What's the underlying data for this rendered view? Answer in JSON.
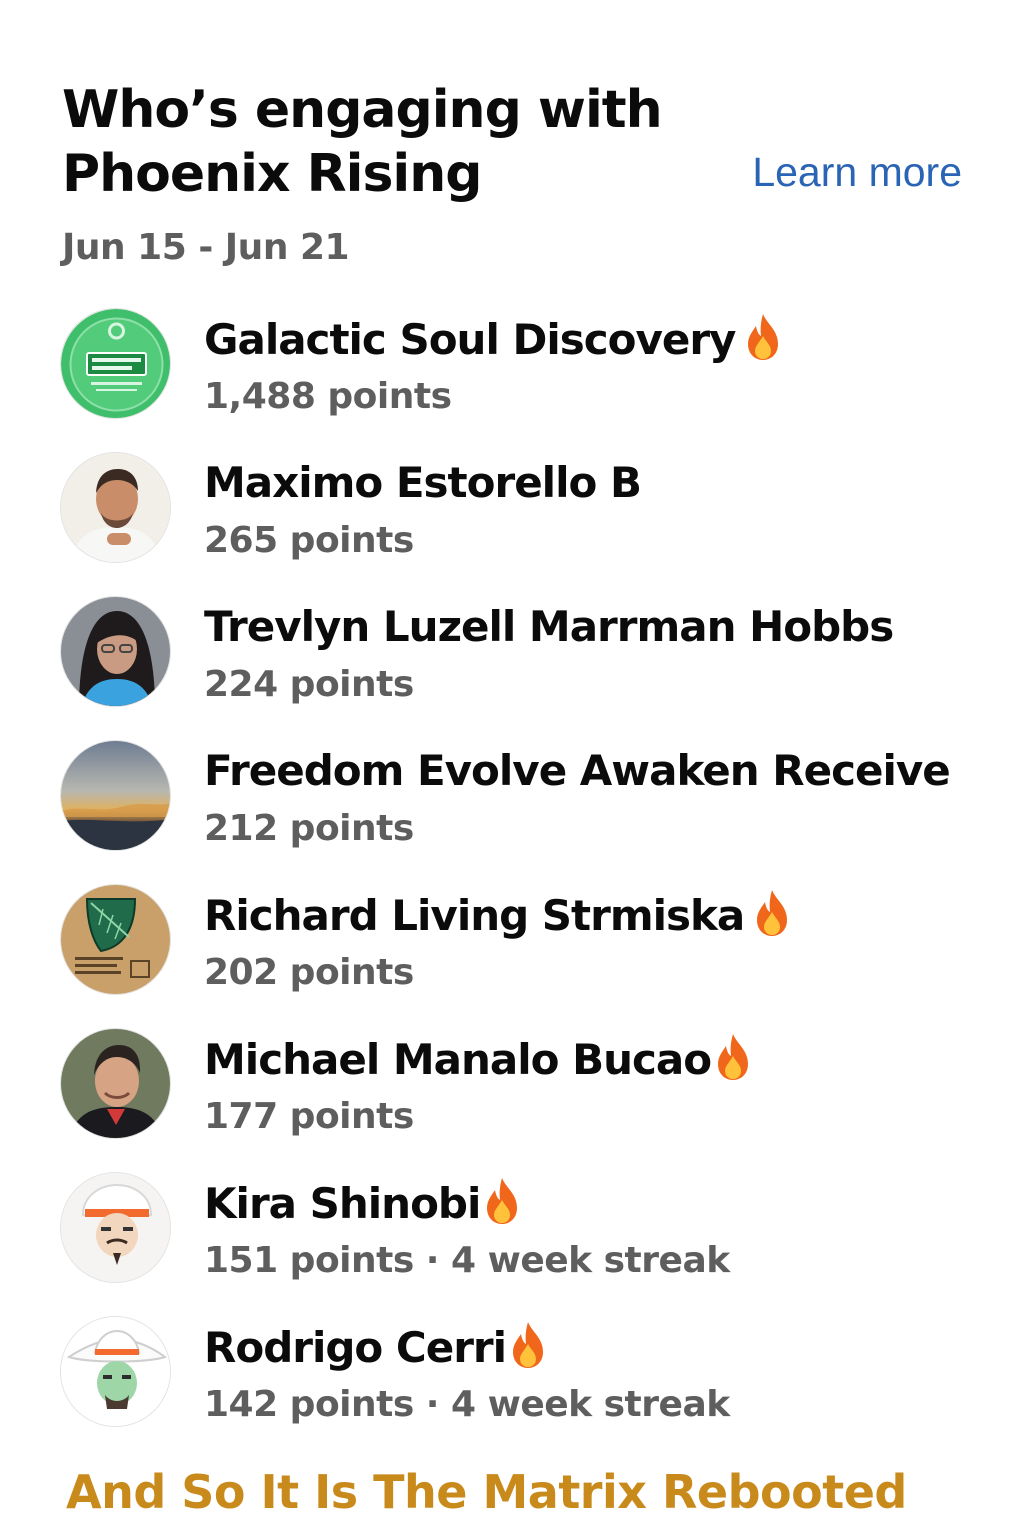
{
  "header": {
    "title": "Who’s engaging with Phoenix Rising",
    "learn_more": "Learn more",
    "date_range": "Jun 15 - Jun 21"
  },
  "colors": {
    "link": "#2a64b5",
    "secondary_text": "#5e5e5e",
    "footer": "#c98a1c",
    "fire": "#f0671c"
  },
  "members": [
    {
      "name": "Galactic Soul Discovery",
      "points": "1,488 points",
      "fire": true,
      "streak": "",
      "avatar_icon": "green-badge-logo"
    },
    {
      "name": "Maximo Estorello B",
      "points": "265 points",
      "fire": false,
      "streak": "",
      "avatar_icon": "man-portrait"
    },
    {
      "name": "Trevlyn Luzell Marrman Hobbs",
      "points": "224 points",
      "fire": false,
      "streak": "",
      "avatar_icon": "woman-portrait"
    },
    {
      "name": "Freedom Evolve Awaken Receive",
      "points": "212 points",
      "fire": false,
      "streak": "",
      "avatar_icon": "sunset-landscape"
    },
    {
      "name": "Richard Living Strmiska",
      "points": "202 points",
      "fire": true,
      "streak": "",
      "avatar_icon": "leaf-emblem"
    },
    {
      "name": "Michael Manalo Bucao",
      "points": "177 points",
      "fire": true,
      "streak": "",
      "avatar_icon": "man-portrait"
    },
    {
      "name": "Kira Shinobi",
      "points": "151 points",
      "fire": true,
      "streak": "4 week streak",
      "avatar_icon": "illustrated-man-hat"
    },
    {
      "name": "Rodrigo Cerri",
      "points": "142 points",
      "fire": true,
      "streak": "4 week streak",
      "avatar_icon": "illustrated-man-hat"
    }
  ],
  "footer": {
    "text": "And So It Is The Matrix Rebooted"
  }
}
